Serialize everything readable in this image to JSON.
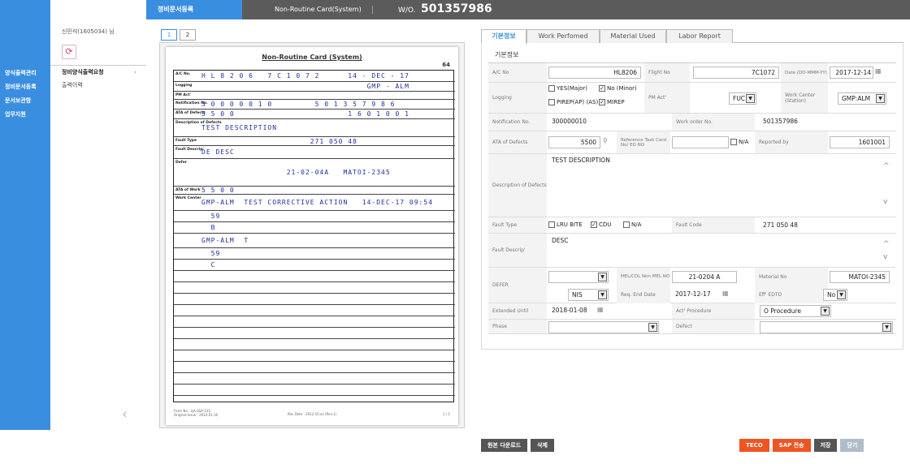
{
  "nav": {
    "items": [
      "양식출력관리",
      "정비문서등록",
      "문서보관함",
      "업무지원"
    ]
  },
  "sidebar": {
    "user": "신민석(1605034) 님",
    "submenu": [
      {
        "label": "정비양식출력요청",
        "chevron": "›"
      },
      {
        "label": "출력이력"
      }
    ]
  },
  "topbar": {
    "tab_active": "정비문서등록",
    "title": "Non-Routine Card(System)",
    "wo_label": "W/O.",
    "wo_value": "501357986"
  },
  "pages": [
    "1",
    "2"
  ],
  "doc": {
    "title": "Non-Routine Card (System)",
    "page_no": "64",
    "rows": [
      {
        "label": "A/C No.",
        "hand": "H L 8 2 0 6   7 C 1 0 7 2      14 - DEC - 17"
      },
      {
        "label": "Logging",
        "hand": "                                   GMP - ALM"
      },
      {
        "label": "PM Act'",
        "hand": ""
      },
      {
        "label": "Notification No.",
        "hand": "3 0 0 0 0 0 1 0         5 0 1 3 5 7 9 8 6"
      },
      {
        "label": "ATA of Defects",
        "hand": "5 5 0 0                        1 6 0 1 0 0 1"
      },
      {
        "label": "Description of Defects",
        "hand": "TEST DESCRIPTION"
      },
      {
        "label": "Fault Type",
        "hand": "                       271 050 48"
      },
      {
        "label": "Fault Descrip'",
        "hand": "DE DESC"
      },
      {
        "label": "Defer",
        "hand": "                  21-02-04A   MATOI-2345"
      },
      {
        "label": "ATA of Work",
        "hand": "5 5 0 0"
      },
      {
        "label": "Work Center",
        "hand": "GMP-ALM  TEST CORRECTIVE ACTION   14-DEC-17 09:54"
      },
      {
        "label": "",
        "hand": "  59"
      },
      {
        "label": "",
        "hand": "  B"
      },
      {
        "label": "",
        "hand": "GMP-ALM  T"
      },
      {
        "label": "",
        "hand": "  59"
      },
      {
        "label": "",
        "hand": "  C"
      }
    ],
    "foot_left": "Form No : LJA-SSA-135\nOriginal Issue : 2014.01.16",
    "foot_mid": "Rev Date : 2012.10.xx (Rev.1)",
    "foot_page": "1 / 1"
  },
  "form_tabs": [
    "기본정보",
    "Work Perfomed",
    "Material Used",
    "Labor Report"
  ],
  "section": "기본정보",
  "form": {
    "ac_no_label": "A/C No",
    "ac_no": "HL8206",
    "flight_label": "Flight No",
    "flight": "7C1072",
    "date_label": "Date (DD-MMM-YY)",
    "date": "2017-12-14",
    "logging_label": "Logging",
    "log_yes": "YES(Major)",
    "log_no": "No (Minor)",
    "log_pirep": "PIREP(AP) (AS)",
    "log_mirep": "MIREP",
    "pm_label": "PM Act'",
    "pm": "FUC",
    "wc_label": "Work Center (Station)",
    "wc": "GMP:ALM",
    "notif_label": "Notification No.",
    "notif": "300000010",
    "wo_label": "Work order No.",
    "wo": "501357986",
    "ata_label": "ATA of Defects",
    "ata": "5500",
    "ref_label": "Reference Task Card No/ EO NO",
    "na": "N/A",
    "rep_label": "Reported by",
    "rep": "1601001",
    "desc_label": "Description of Defects",
    "desc": "TEST DESCRIPTION",
    "ft_label": "Fault Type",
    "ft_lru": "LRU BITE",
    "ft_cdu": "CDU",
    "ft_na": "N/A",
    "fc_label": "Fault Code",
    "fc": "271 050 48",
    "fd_label": "Fault Descrip'",
    "fd": "DESC",
    "defer_label": "DEFER",
    "mel_label": "MEL/CDL Non MEL NO",
    "mel": "21-0204 A",
    "mat_label": "Material No",
    "mat": "MATOI-2345",
    "nis": "NIS",
    "req_label": "Req. End Date",
    "req": "2017-12-17",
    "eff_label": "Eff' EDTO",
    "eff": "No",
    "ext_label": "Extended Until",
    "ext": "2018-01-08",
    "act_label": "Act' Procedure",
    "act": "O Procedure",
    "phase_label": "Phase",
    "defect_label": "Defect"
  },
  "buttons_left": [
    "원본 다운로드",
    "삭제"
  ],
  "buttons_right": [
    "TECO",
    "SAP 전송",
    "저장",
    "닫기"
  ]
}
